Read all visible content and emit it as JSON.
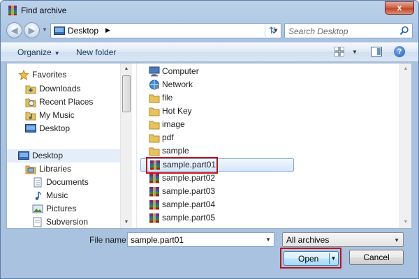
{
  "window": {
    "title": "Find archive",
    "close_label": "x"
  },
  "nav": {
    "address": {
      "crumbs": [
        "Desktop"
      ]
    },
    "search": {
      "placeholder": "Search Desktop"
    }
  },
  "toolbar": {
    "organize_label": "Organize",
    "new_folder_label": "New folder"
  },
  "navpane": {
    "items": [
      {
        "label": "Favorites",
        "icon": "star-icon"
      },
      {
        "label": "Downloads",
        "icon": "downloads-folder-icon"
      },
      {
        "label": "Recent Places",
        "icon": "recent-places-icon"
      },
      {
        "label": "My Music",
        "icon": "music-folder-icon"
      },
      {
        "label": "Desktop",
        "icon": "desktop-icon"
      },
      {
        "label": "Desktop",
        "icon": "desktop-icon"
      },
      {
        "label": "Libraries",
        "icon": "libraries-icon"
      },
      {
        "label": "Documents",
        "icon": "documents-icon"
      },
      {
        "label": "Music",
        "icon": "music-note-icon"
      },
      {
        "label": "Pictures",
        "icon": "pictures-icon"
      },
      {
        "label": "Subversion",
        "icon": "subversion-icon"
      }
    ]
  },
  "files": [
    {
      "name": "Computer",
      "icon": "computer-icon"
    },
    {
      "name": "Network",
      "icon": "network-icon"
    },
    {
      "name": "file",
      "icon": "folder-icon"
    },
    {
      "name": "Hot Key",
      "icon": "folder-icon"
    },
    {
      "name": "image",
      "icon": "folder-icon"
    },
    {
      "name": "pdf",
      "icon": "folder-icon"
    },
    {
      "name": "sample",
      "icon": "folder-icon"
    },
    {
      "name": "sample.part01",
      "icon": "rar-archive-icon",
      "selected": true
    },
    {
      "name": "sample.part02",
      "icon": "rar-archive-icon"
    },
    {
      "name": "sample.part03",
      "icon": "rar-archive-icon"
    },
    {
      "name": "sample.part04",
      "icon": "rar-archive-icon"
    },
    {
      "name": "sample.part05",
      "icon": "rar-archive-icon"
    }
  ],
  "footer": {
    "file_name_label": "File name:",
    "file_name_value": "sample.part01",
    "file_type_value": "All archives",
    "open_label": "Open",
    "cancel_label": "Cancel"
  },
  "colors": {
    "highlight": "#c0121b",
    "selection": "#d4e6fb",
    "folder": "#e8c25a"
  }
}
